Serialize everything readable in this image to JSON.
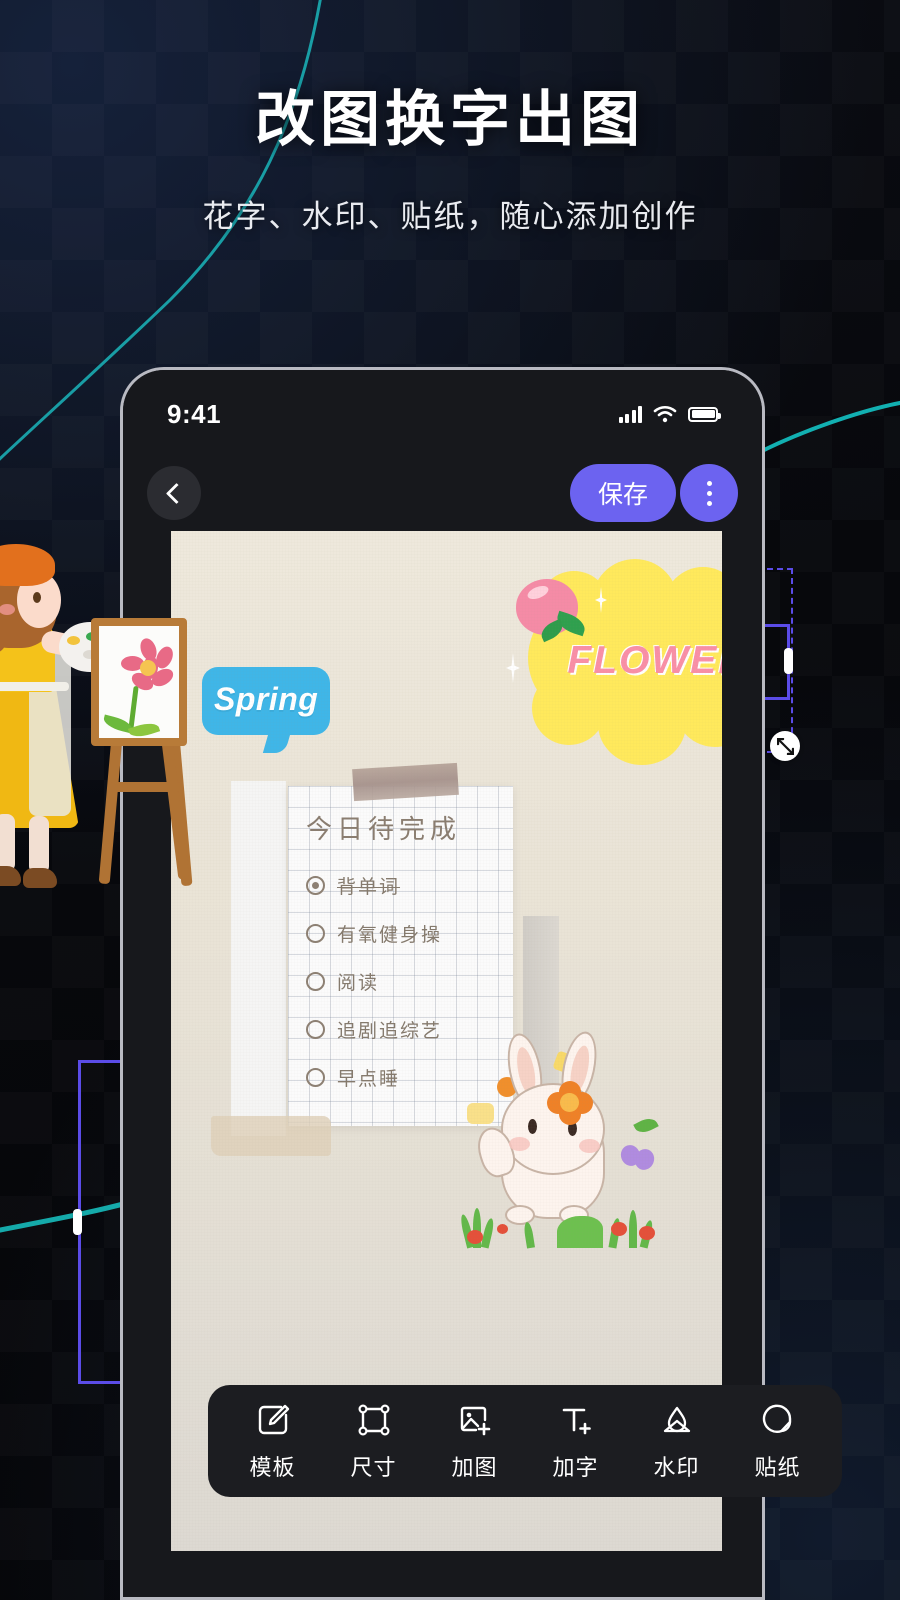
{
  "hero": {
    "title": "改图换字出图",
    "subtitle": "花字、水印、贴纸，随心添加创作"
  },
  "phone": {
    "status_bar": {
      "clock": "9:41",
      "signal_icon": "cellular-signal-icon",
      "wifi_icon": "wifi-icon",
      "battery_icon": "battery-full-icon"
    },
    "nav_bar": {
      "back_icon": "chevron-left-icon",
      "save_label": "保存",
      "more_icon": "more-vertical-icon"
    }
  },
  "canvas": {
    "checklist": {
      "title": "今日待完成",
      "items": [
        {
          "text": "背单词",
          "done": true
        },
        {
          "text": "有氧健身操",
          "done": false
        },
        {
          "text": "阅读",
          "done": false
        },
        {
          "text": "追剧追综艺",
          "done": false
        },
        {
          "text": "早点睡",
          "done": false
        }
      ]
    },
    "stickers": [
      {
        "id": "spring",
        "text": "Spring",
        "selected": true,
        "frame": "dashed"
      },
      {
        "id": "flower",
        "text": "FLOWER",
        "selected": true,
        "frame": "dashed"
      },
      {
        "id": "bunny",
        "text": "",
        "selected": true,
        "frame": "solid"
      },
      {
        "id": "girl-painter",
        "text": "",
        "selected": true,
        "frame": "solid"
      }
    ],
    "handles": {
      "rotate_icon": "rotate-icon",
      "resize_icon": "resize-corner-icon",
      "crop_icon": "crop-corner-icon"
    }
  },
  "toolbar": {
    "items": [
      {
        "label": "模板",
        "icon": "template-pencil-icon"
      },
      {
        "label": "尺寸",
        "icon": "crop-size-icon"
      },
      {
        "label": "加图",
        "icon": "add-image-icon"
      },
      {
        "label": "加字",
        "icon": "add-text-icon"
      },
      {
        "label": "水印",
        "icon": "watermark-droplet-icon"
      },
      {
        "label": "贴纸",
        "icon": "sticker-icon"
      }
    ]
  },
  "colors": {
    "accent_purple": "#6C63F0",
    "selection_purple": "#5B4CE8",
    "background_dark": "#050507",
    "curve_teal": "#16b3b3",
    "sticker_yellow": "#FFE95C",
    "sticker_blue": "#3FB6E8",
    "sticker_pink": "#F98FA6"
  }
}
